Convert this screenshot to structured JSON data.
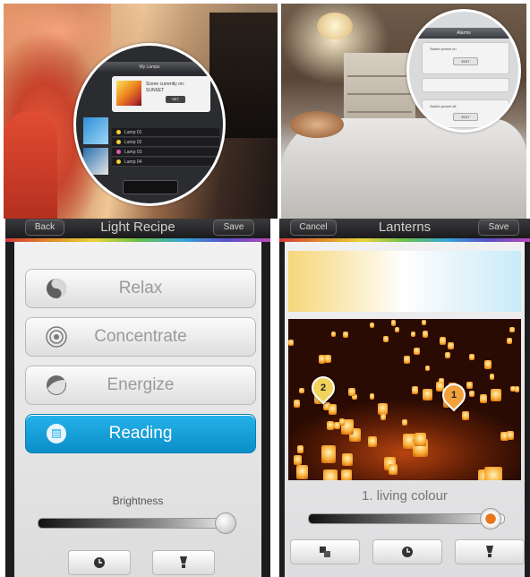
{
  "left_phone": {
    "title": "Light Recipe",
    "back_label": "Back",
    "save_label": "Save",
    "recipes": [
      {
        "label": "Relax",
        "icon": "relax-icon",
        "selected": false
      },
      {
        "label": "Concentrate",
        "icon": "concentrate-icon",
        "selected": false
      },
      {
        "label": "Energize",
        "icon": "energize-icon",
        "selected": false
      },
      {
        "label": "Reading",
        "icon": "reading-icon",
        "selected": true
      }
    ],
    "brightness_label": "Brightness",
    "brightness_level": 0.95,
    "toolbar": [
      "clock-icon",
      "bulb-icon"
    ]
  },
  "right_phone": {
    "title": "Lanterns",
    "cancel_label": "Cancel",
    "save_label": "Save",
    "markers": [
      "1",
      "2"
    ],
    "caption": "1. living colour",
    "slider_level": 0.93,
    "toolbar": [
      "lamps-icon",
      "clock-icon",
      "bulb-icon"
    ]
  },
  "colors": {
    "selected_blue": "#19a3dc",
    "slider_accent": "#e8761c"
  }
}
